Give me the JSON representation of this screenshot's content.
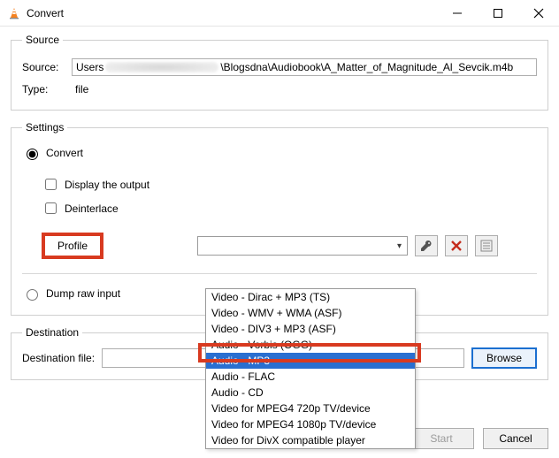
{
  "window": {
    "title": "Convert"
  },
  "source": {
    "legend": "Source",
    "source_label": "Source:",
    "source_value_prefix": "Users",
    "source_value_suffix": "\\Blogsdna\\Audiobook\\A_Matter_of_Magnitude_Al_Sevcik.m4b",
    "type_label": "Type:",
    "type_value": "file"
  },
  "settings": {
    "legend": "Settings",
    "convert_label": "Convert",
    "display_output_label": "Display the output",
    "deinterlace_label": "Deinterlace",
    "profile_label": "Profile",
    "profile_selected": "Audio - MP3",
    "profile_options": [
      "Video - Dirac + MP3 (TS)",
      "Video - WMV + WMA (ASF)",
      "Video - DIV3 + MP3 (ASF)",
      "Audio - Vorbis (OGG)",
      "Audio - MP3",
      "Audio - FLAC",
      "Audio - CD",
      "Video for MPEG4 720p TV/device",
      "Video for MPEG4 1080p TV/device",
      "Video for DivX compatible player"
    ],
    "profile_selected_index": 4,
    "dump_raw_label": "Dump raw input"
  },
  "destination": {
    "legend": "Destination",
    "file_label": "Destination file:",
    "file_value": "",
    "browse_label": "Browse"
  },
  "footer": {
    "start_label": "Start",
    "cancel_label": "Cancel"
  },
  "icons": {
    "wrench": "wrench-icon",
    "delete": "delete-icon",
    "new_profile": "new-profile-icon"
  }
}
